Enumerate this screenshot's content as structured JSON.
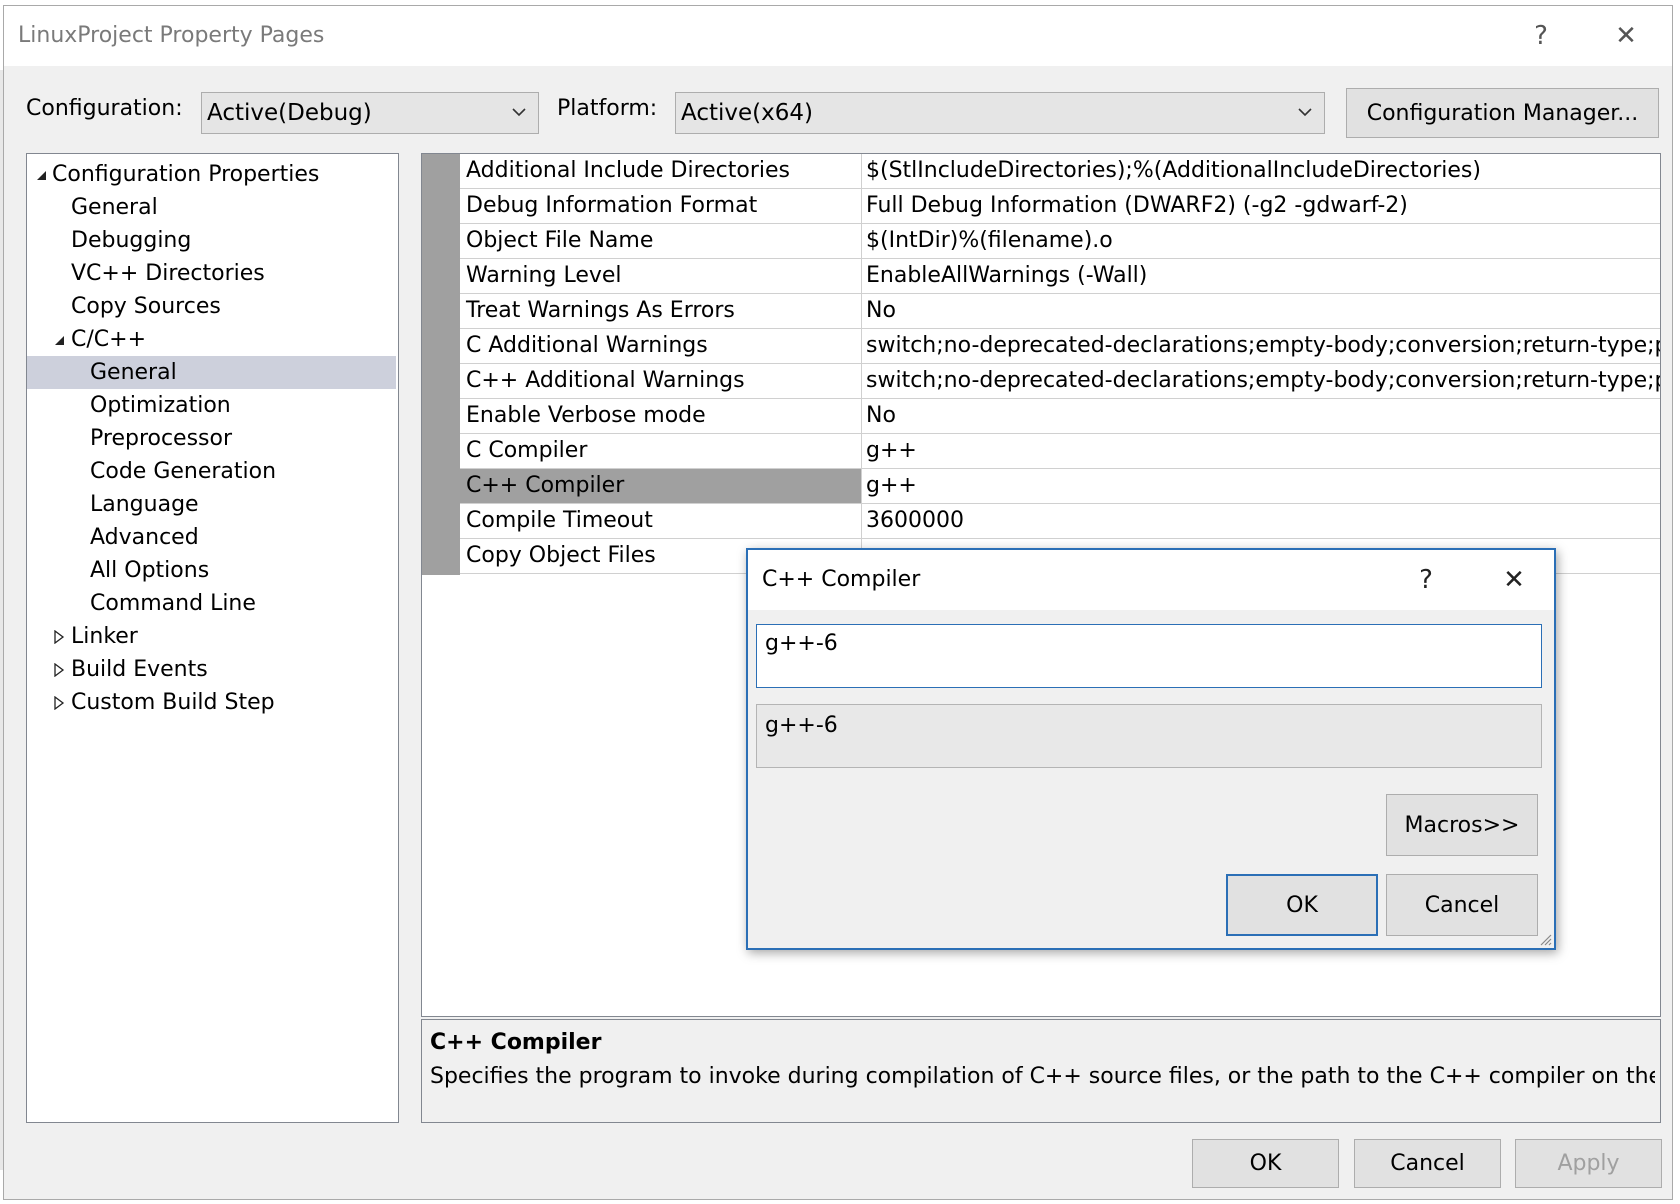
{
  "window": {
    "title": "LinuxProject Property Pages",
    "help_glyph": "?",
    "close_glyph": "✕"
  },
  "toolbar": {
    "configuration_label": "Configuration:",
    "configuration_value": "Active(Debug)",
    "platform_label": "Platform:",
    "platform_value": "Active(x64)",
    "config_manager_label": "Configuration Manager..."
  },
  "tree": {
    "items": [
      {
        "label": "Configuration Properties"
      },
      {
        "label": "General"
      },
      {
        "label": "Debugging"
      },
      {
        "label": "VC++ Directories"
      },
      {
        "label": "Copy Sources"
      },
      {
        "label": "C/C++"
      },
      {
        "label": "General"
      },
      {
        "label": "Optimization"
      },
      {
        "label": "Preprocessor"
      },
      {
        "label": "Code Generation"
      },
      {
        "label": "Language"
      },
      {
        "label": "Advanced"
      },
      {
        "label": "All Options"
      },
      {
        "label": "Command Line"
      },
      {
        "label": "Linker"
      },
      {
        "label": "Build Events"
      },
      {
        "label": "Custom Build Step"
      }
    ]
  },
  "grid": {
    "rows": [
      {
        "name": "Additional Include Directories",
        "value": "$(StlIncludeDirectories);%(AdditionalIncludeDirectories)"
      },
      {
        "name": "Debug Information Format",
        "value": "Full Debug Information (DWARF2) (-g2 -gdwarf-2)"
      },
      {
        "name": "Object File Name",
        "value": "$(IntDir)%(filename).o"
      },
      {
        "name": "Warning Level",
        "value": "EnableAllWarnings (-Wall)"
      },
      {
        "name": "Treat Warnings As Errors",
        "value": "No"
      },
      {
        "name": "C Additional Warnings",
        "value": "switch;no-deprecated-declarations;empty-body;conversion;return-type;par"
      },
      {
        "name": "C++ Additional Warnings",
        "value": "switch;no-deprecated-declarations;empty-body;conversion;return-type;par"
      },
      {
        "name": "Enable Verbose mode",
        "value": "No"
      },
      {
        "name": "C Compiler",
        "value": "g++"
      },
      {
        "name": "C++ Compiler",
        "value": "g++"
      },
      {
        "name": "Compile Timeout",
        "value": "3600000"
      },
      {
        "name": "Copy Object Files",
        "value": ""
      }
    ]
  },
  "description": {
    "title": "C++ Compiler",
    "text": "Specifies the program to invoke during compilation of C++ source files, or the path to the C++ compiler on the..."
  },
  "edit_dialog": {
    "title": "C++ Compiler",
    "help_glyph": "?",
    "close_glyph": "✕",
    "input_value": "g++-6",
    "preview_value": "g++-6",
    "macros_label": "Macros>>",
    "ok_label": "OK",
    "cancel_label": "Cancel"
  },
  "footer": {
    "ok_label": "OK",
    "cancel_label": "Cancel",
    "apply_label": "Apply"
  },
  "colors": {
    "selection": "#cdd0dc",
    "grid_selection": "#a0a0a0",
    "accent": "#2b6fb6",
    "disabled_text": "#a0a0a0"
  }
}
